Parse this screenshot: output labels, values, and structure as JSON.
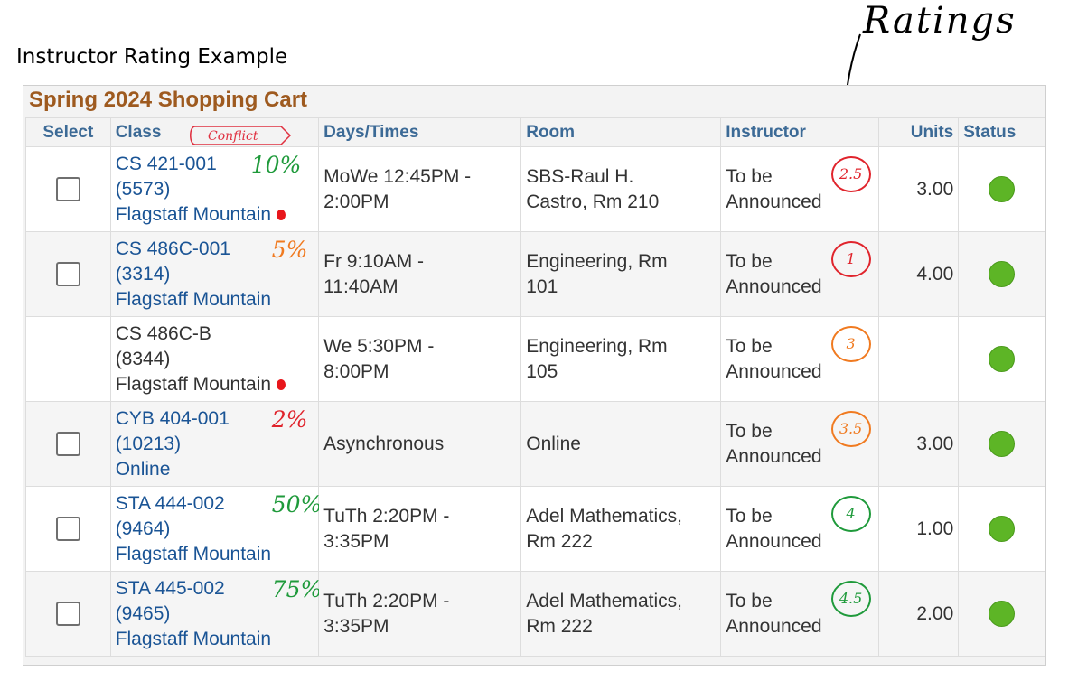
{
  "caption": "Instructor Rating Example",
  "annotation": {
    "ratings_label": "Ratings",
    "conflict_label": "Conflict"
  },
  "cart": {
    "title": "Spring 2024 Shopping Cart",
    "headers": {
      "select": "Select",
      "class": "Class",
      "days_times": "Days/Times",
      "room": "Room",
      "instructor": "Instructor",
      "units": "Units",
      "status": "Status"
    },
    "rows": [
      {
        "code": "CS 421-001",
        "number": "(5573)",
        "campus": "Flagstaff Mountain",
        "selectable": true,
        "linked": true,
        "conflict": true,
        "pct": "10%",
        "pct_color": "#1f9a3b",
        "days_1": "MoWe 12:45PM -",
        "days_2": "2:00PM",
        "room_1": "SBS-Raul H.",
        "room_2": "Castro, Rm 210",
        "instr_1": "To be",
        "instr_2": "Announced",
        "rating": "2.5",
        "rating_color": "#e0242c",
        "units": "3.00",
        "status": "open"
      },
      {
        "code": "CS 486C-001",
        "number": "(3314)",
        "campus": "Flagstaff Mountain",
        "selectable": true,
        "linked": true,
        "conflict": false,
        "pct": "5%",
        "pct_color": "#f07a20",
        "days_1": "Fr 9:10AM -",
        "days_2": "11:40AM",
        "room_1": "Engineering, Rm",
        "room_2": "101",
        "instr_1": "To be",
        "instr_2": "Announced",
        "rating": "1",
        "rating_color": "#e0242c",
        "units": "4.00",
        "status": "open"
      },
      {
        "code": "CS 486C-B",
        "number": "(8344)",
        "campus": "Flagstaff Mountain",
        "selectable": false,
        "linked": false,
        "conflict": true,
        "pct": "",
        "pct_color": "#000000",
        "days_1": "We 5:30PM -",
        "days_2": "8:00PM",
        "room_1": "Engineering, Rm",
        "room_2": "105",
        "instr_1": "To be",
        "instr_2": "Announced",
        "rating": "3",
        "rating_color": "#f07a20",
        "units": "",
        "status": "open"
      },
      {
        "code": "CYB 404-001",
        "number": "(10213)",
        "campus": "Online",
        "selectable": true,
        "linked": true,
        "conflict": false,
        "pct": "2%",
        "pct_color": "#e0242c",
        "days_1": "Asynchronous",
        "days_2": "",
        "room_1": "Online",
        "room_2": "",
        "instr_1": "To be",
        "instr_2": "Announced",
        "rating": "3.5",
        "rating_color": "#f07a20",
        "units": "3.00",
        "status": "open"
      },
      {
        "code": "STA 444-002",
        "number": "(9464)",
        "campus": "Flagstaff Mountain",
        "selectable": true,
        "linked": true,
        "conflict": false,
        "pct": "50%",
        "pct_color": "#1f9a3b",
        "days_1": "TuTh 2:20PM -",
        "days_2": "3:35PM",
        "room_1": "Adel Mathematics,",
        "room_2": "Rm 222",
        "instr_1": "To be",
        "instr_2": "Announced",
        "rating": "4",
        "rating_color": "#1f9a3b",
        "units": "1.00",
        "status": "open"
      },
      {
        "code": "STA 445-002",
        "number": "(9465)",
        "campus": "Flagstaff Mountain",
        "selectable": true,
        "linked": true,
        "conflict": false,
        "pct": "75%",
        "pct_color": "#1f9a3b",
        "days_1": "TuTh 2:20PM -",
        "days_2": "3:35PM",
        "room_1": "Adel Mathematics,",
        "room_2": "Rm 222",
        "instr_1": "To be",
        "instr_2": "Announced",
        "rating": "4.5",
        "rating_color": "#1f9a3b",
        "units": "2.00",
        "status": "open"
      }
    ]
  }
}
